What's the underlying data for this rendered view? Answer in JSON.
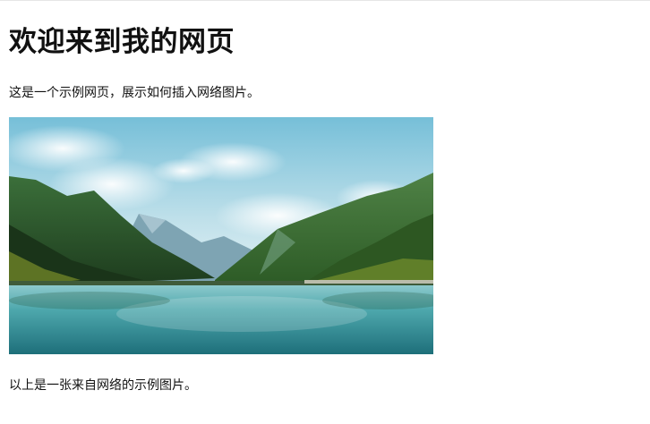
{
  "page": {
    "heading": "欢迎来到我的网页",
    "intro": "这是一个示例网页，展示如何插入网络图片。",
    "caption": "以上是一张来自网络的示例图片。"
  },
  "image": {
    "subject": "mountain lake landscape",
    "colors": {
      "sky_top": "#7ec3dc",
      "sky_bottom": "#d9edf3",
      "mountain_far": "#7fa6b6",
      "mountain_near_left": "#264d24",
      "mountain_near_right": "#3b6b2f",
      "water": "#3e9aa2"
    }
  }
}
